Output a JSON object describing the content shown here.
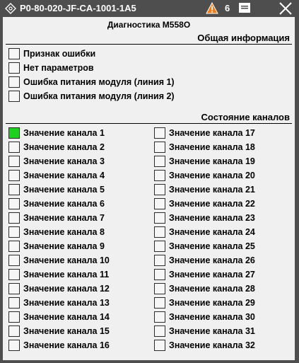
{
  "window": {
    "title": "P0-80-020-JF-CA-1001-1A5",
    "alarm_count": "6",
    "icons": {
      "app": "diamond-icon",
      "warning": "warning-triangle-icon",
      "menu": "menu-icon",
      "close": "close-icon"
    },
    "warning_color": "#f07c1a"
  },
  "diagnostics": {
    "title": "Диагностика M558O",
    "general": {
      "header": "Общая информация",
      "items": [
        {
          "label": "Признак ошибки",
          "checked": false
        },
        {
          "label": "Нет параметров",
          "checked": false
        },
        {
          "label": "Ошибка питания модуля (линия 1)",
          "checked": false
        },
        {
          "label": "Ошибка питания модуля (линия 2)",
          "checked": false
        }
      ]
    },
    "channels": {
      "header": "Состояние каналов",
      "active_color": "#1fd11f",
      "left": [
        {
          "label": "Значение канала 1",
          "checked": true
        },
        {
          "label": "Значение канала 2",
          "checked": false
        },
        {
          "label": "Значение канала 3",
          "checked": false
        },
        {
          "label": "Значение канала 4",
          "checked": false
        },
        {
          "label": "Значение канала 5",
          "checked": false
        },
        {
          "label": "Значение канала 6",
          "checked": false
        },
        {
          "label": "Значение канала 7",
          "checked": false
        },
        {
          "label": "Значение канала 8",
          "checked": false
        },
        {
          "label": "Значение канала 9",
          "checked": false
        },
        {
          "label": "Значение канала 10",
          "checked": false
        },
        {
          "label": "Значение канала 11",
          "checked": false
        },
        {
          "label": "Значение канала 12",
          "checked": false
        },
        {
          "label": "Значение канала 13",
          "checked": false
        },
        {
          "label": "Значение канала 14",
          "checked": false
        },
        {
          "label": "Значение канала 15",
          "checked": false
        },
        {
          "label": "Значение канала 16",
          "checked": false
        }
      ],
      "right": [
        {
          "label": "Значение канала 17",
          "checked": false
        },
        {
          "label": "Значение канала 18",
          "checked": false
        },
        {
          "label": "Значение канала 19",
          "checked": false
        },
        {
          "label": "Значение канала 20",
          "checked": false
        },
        {
          "label": "Значение канала 21",
          "checked": false
        },
        {
          "label": "Значение канала 22",
          "checked": false
        },
        {
          "label": "Значение канала 23",
          "checked": false
        },
        {
          "label": "Значение канала 24",
          "checked": false
        },
        {
          "label": "Значение канала 25",
          "checked": false
        },
        {
          "label": "Значение канала 26",
          "checked": false
        },
        {
          "label": "Значение канала 27",
          "checked": false
        },
        {
          "label": "Значение канала 28",
          "checked": false
        },
        {
          "label": "Значение канала 29",
          "checked": false
        },
        {
          "label": "Значение канала 30",
          "checked": false
        },
        {
          "label": "Значение канала 31",
          "checked": false
        },
        {
          "label": "Значение канала 32",
          "checked": false
        }
      ]
    }
  }
}
